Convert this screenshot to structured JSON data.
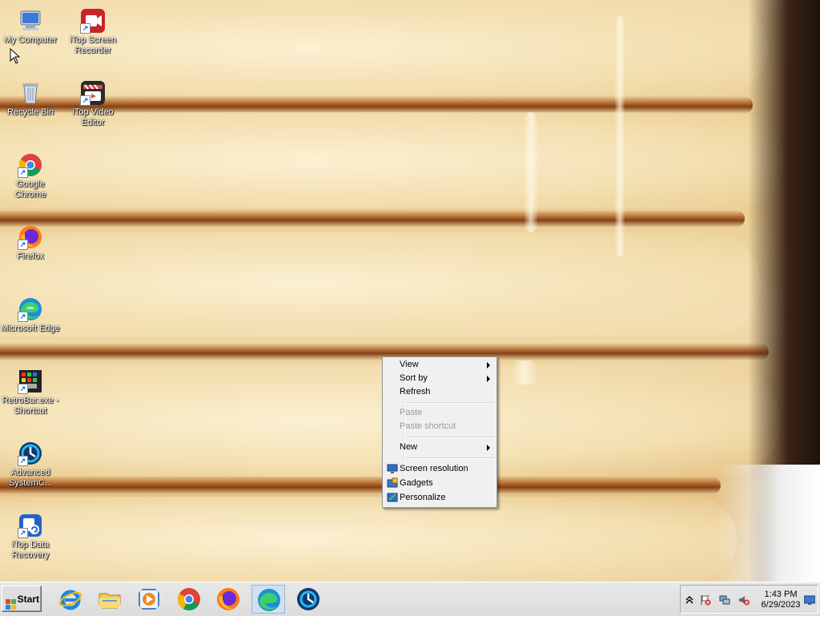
{
  "desktop": {
    "icons": [
      {
        "label": "My Computer",
        "icon": "computer-icon"
      },
      {
        "label": "iTop Screen Recorder",
        "icon": "screen-recorder-icon"
      },
      {
        "label": "Recycle Bin",
        "icon": "recycle-bin-icon"
      },
      {
        "label": "iTop Video Editor",
        "icon": "video-editor-icon"
      },
      {
        "label": "Google Chrome",
        "icon": "chrome-icon"
      },
      {
        "label": "Firefox",
        "icon": "firefox-icon"
      },
      {
        "label": "Microsoft Edge",
        "icon": "edge-icon"
      },
      {
        "label": "RetroBar.exe - Shortcut",
        "icon": "retrobar-icon"
      },
      {
        "label": "Advanced SystemC...",
        "icon": "advanced-systemcare-icon"
      },
      {
        "label": "iTop Data Recovery",
        "icon": "data-recovery-icon"
      }
    ]
  },
  "context_menu": {
    "items": [
      {
        "label": "View",
        "submenu": true,
        "enabled": true
      },
      {
        "label": "Sort by",
        "submenu": true,
        "enabled": true
      },
      {
        "label": "Refresh",
        "enabled": true
      },
      {
        "label": "Paste",
        "enabled": false
      },
      {
        "label": "Paste shortcut",
        "enabled": false
      },
      {
        "label": "New",
        "submenu": true,
        "enabled": true
      },
      {
        "label": "Screen resolution",
        "enabled": true,
        "icon": "screen-resolution-icon"
      },
      {
        "label": "Gadgets",
        "enabled": true,
        "icon": "gadgets-icon"
      },
      {
        "label": "Personalize",
        "enabled": true,
        "icon": "personalize-icon"
      }
    ]
  },
  "taskbar": {
    "start_label": "Start",
    "pinned": [
      {
        "icon": "internet-explorer-icon"
      },
      {
        "icon": "file-explorer-icon"
      },
      {
        "icon": "media-player-icon"
      },
      {
        "icon": "chrome-icon"
      },
      {
        "icon": "firefox-icon"
      },
      {
        "icon": "edge-icon",
        "active": true
      },
      {
        "icon": "advanced-systemcare-icon"
      }
    ],
    "tray": {
      "icons": [
        "show-hidden-icons-chevron",
        "action-center-flag-icon",
        "network-icon",
        "volume-muted-icon",
        "show-desktop-icon"
      ],
      "time": "1:43 PM",
      "date": "6/29/2023"
    }
  },
  "colors": {
    "taskbar_bg": "#dcdcdc",
    "menu_bg": "#f0f0f0",
    "active_taskbar_item": "#cfe0f1"
  }
}
